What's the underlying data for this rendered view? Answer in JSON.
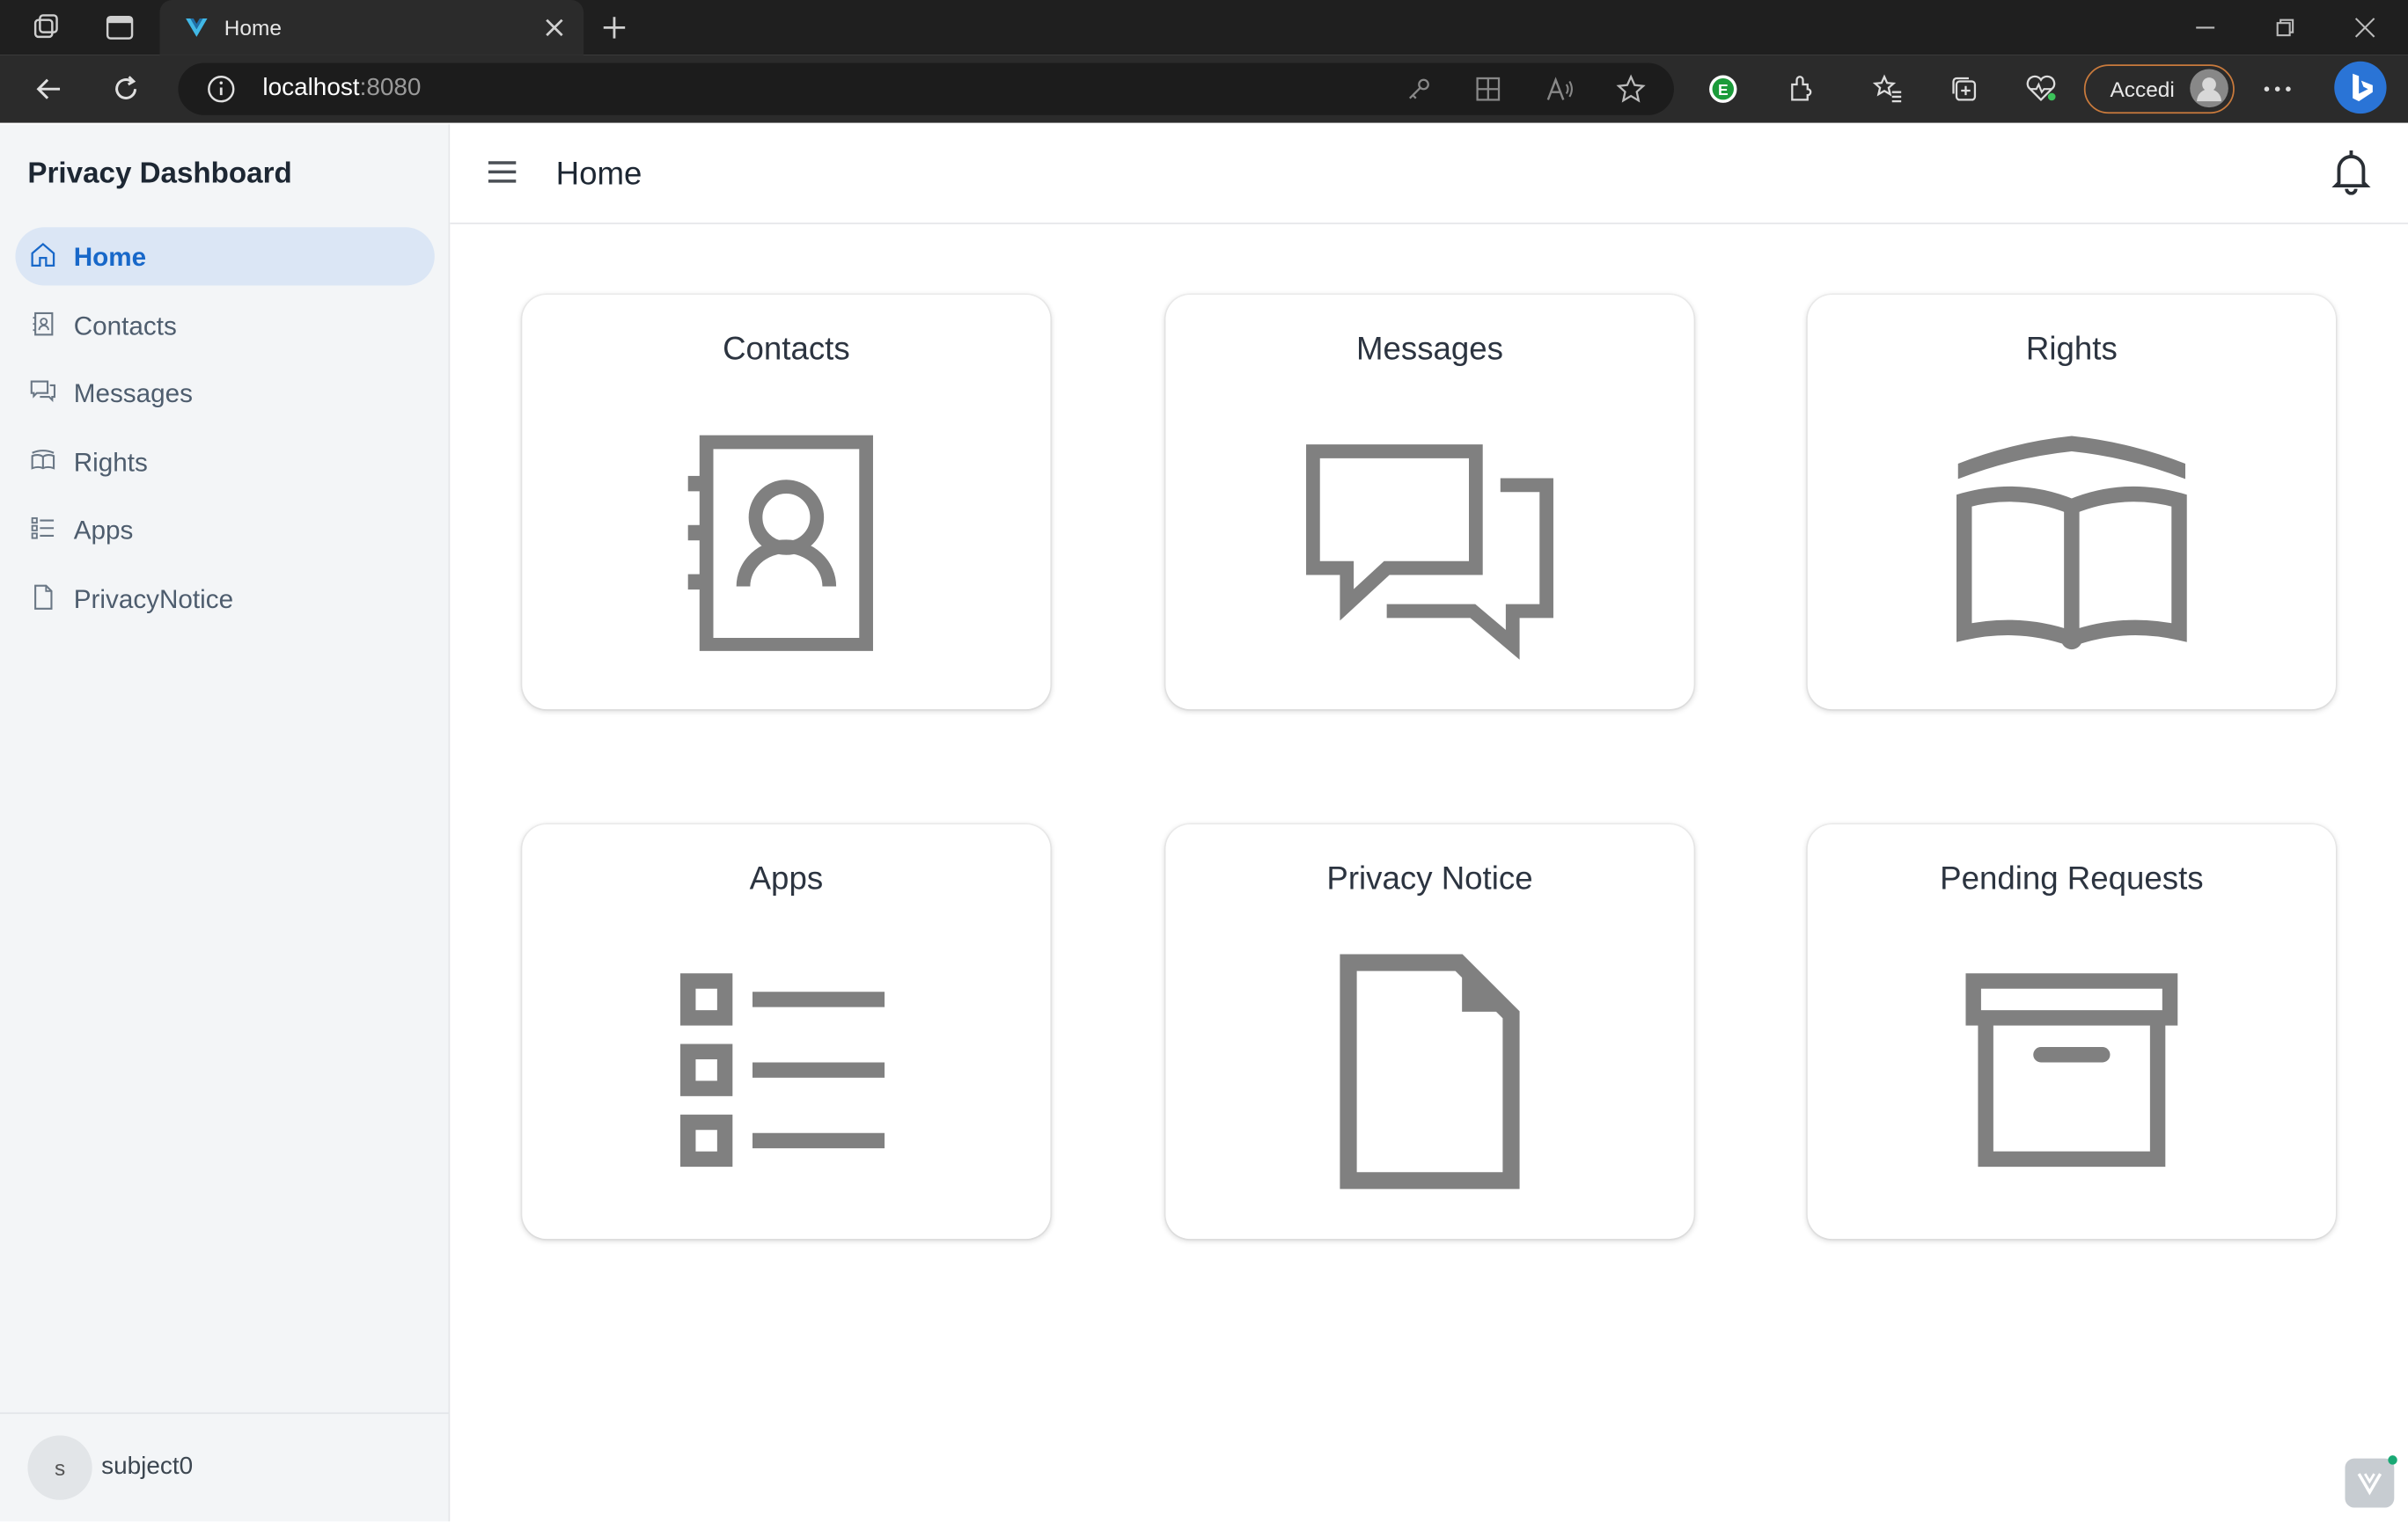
{
  "browser": {
    "tab_title": "Home",
    "url_host": "localhost",
    "url_port": ":8080",
    "signin_label": "Accedi"
  },
  "sidebar": {
    "title": "Privacy Dashboard",
    "items": [
      {
        "label": "Home",
        "icon": "home-icon",
        "active": true
      },
      {
        "label": "Contacts",
        "icon": "contact-card-icon"
      },
      {
        "label": "Messages",
        "icon": "chat-icon"
      },
      {
        "label": "Rights",
        "icon": "book-icon"
      },
      {
        "label": "Apps",
        "icon": "list-icon"
      },
      {
        "label": "PrivacyNotice",
        "icon": "document-icon"
      }
    ],
    "user": {
      "initial": "s",
      "name": "subject0"
    }
  },
  "header": {
    "title": "Home"
  },
  "cards": [
    {
      "title": "Contacts",
      "icon": "contact-book-icon"
    },
    {
      "title": "Messages",
      "icon": "chat-bubbles-icon"
    },
    {
      "title": "Rights",
      "icon": "open-book-icon"
    },
    {
      "title": "Apps",
      "icon": "checklist-icon"
    },
    {
      "title": "Privacy Notice",
      "icon": "document-icon"
    },
    {
      "title": "Pending Requests",
      "icon": "archive-box-icon"
    }
  ],
  "colors": {
    "accent": "#1868c9",
    "active_bg": "#dbe6f5",
    "icon_gray": "#808080"
  }
}
